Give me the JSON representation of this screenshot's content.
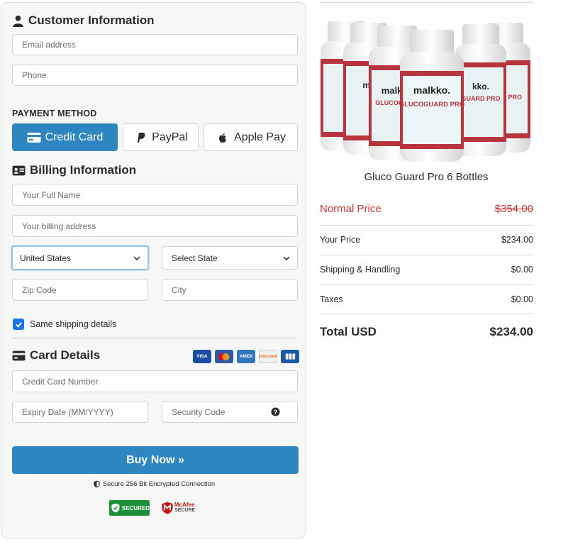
{
  "customer": {
    "title": "Customer Information",
    "email_placeholder": "Email address",
    "phone_placeholder": "Phone"
  },
  "payment": {
    "label": "PAYMENT METHOD",
    "methods": [
      "Credit Card",
      "PayPal",
      "Apple Pay"
    ],
    "selected": "Credit Card"
  },
  "billing": {
    "title": "Billing Information",
    "name_placeholder": "Your Full Name",
    "address_placeholder": "Your billing address",
    "country_value": "United States",
    "state_value": "Select State",
    "zip_placeholder": "Zip Code",
    "city_placeholder": "City",
    "same_shipping_label": "Same shipping details",
    "same_shipping_checked": true
  },
  "card": {
    "title": "Card Details",
    "brand_logos": [
      "VISA",
      "mastercard-logo",
      "AMEX",
      "DISCOVER",
      "JCB"
    ],
    "number_placeholder": "Credit Card Number",
    "expiry_placeholder": "Expiry Date (MM/YYYY)",
    "cvv_placeholder": "Security Code"
  },
  "actions": {
    "buy_label": "Buy Now »",
    "secure_note": "Secure 256 Bit Encrypted Connection",
    "badge_secured": "SECURED",
    "badge_mcafee_top": "McAfee",
    "badge_mcafee_bottom": "SECURE"
  },
  "summary": {
    "product_name": "Gluco Guard Pro 6 Bottles",
    "product_brand": "malkko.",
    "product_label": "GLUCOGUARD PRO",
    "normal_price_label": "Normal Price",
    "normal_price": "$354.00",
    "your_price_label": "Your Price",
    "your_price": "$234.00",
    "shipping_label": "Shipping & Handling",
    "shipping": "$0.00",
    "taxes_label": "Taxes",
    "taxes": "$0.00",
    "total_label": "Total USD",
    "total": "$234.00"
  },
  "colors": {
    "primary": "#2e86c1",
    "strike_red": "#c8373b",
    "panel_bg": "#f7f7f8"
  }
}
